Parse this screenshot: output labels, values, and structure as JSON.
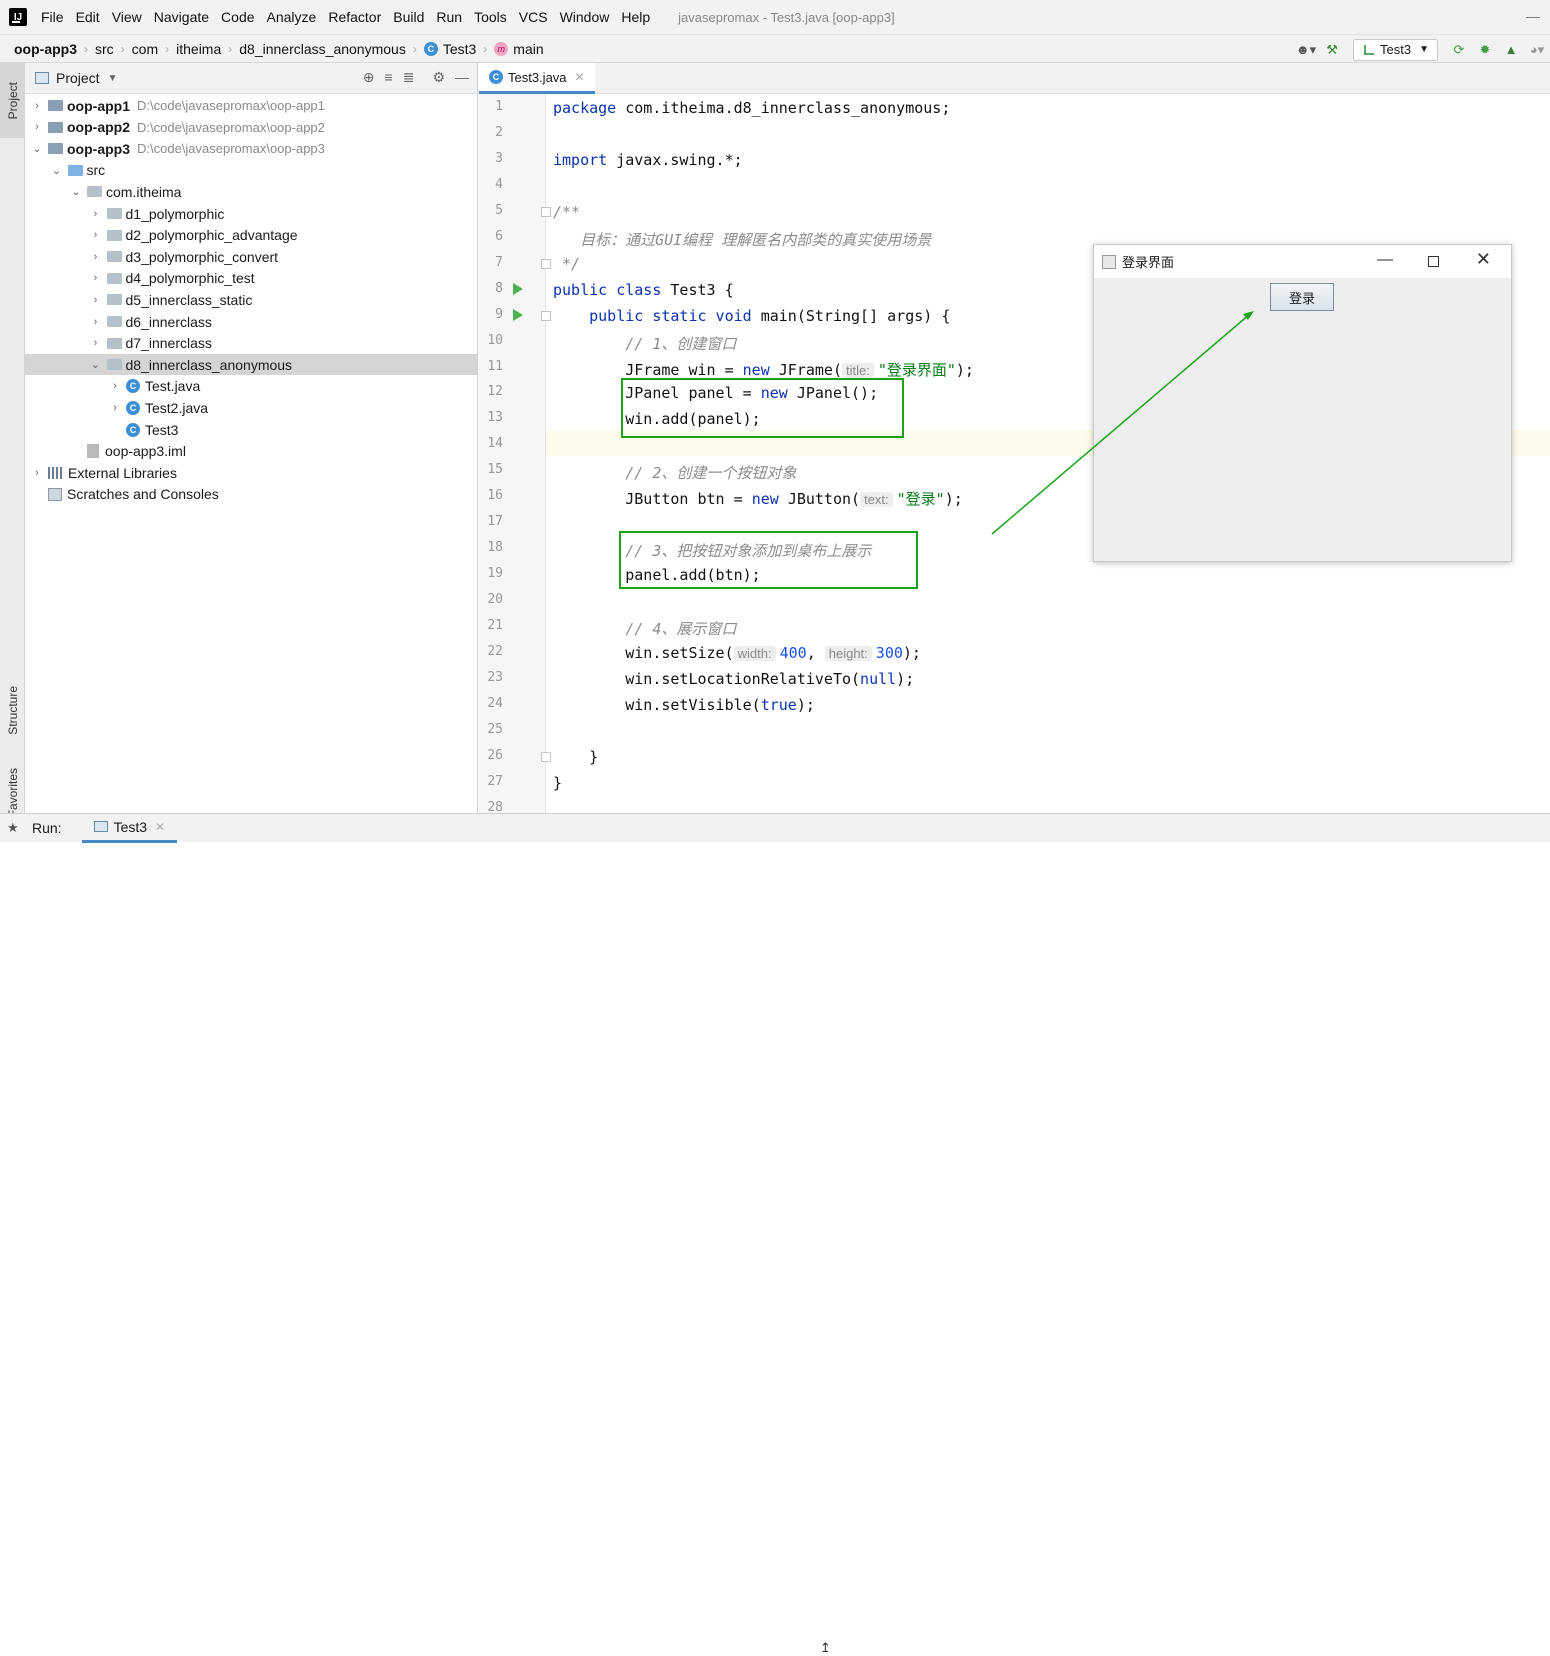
{
  "menubar": {
    "logo": "IJ",
    "items": [
      "File",
      "Edit",
      "View",
      "Navigate",
      "Code",
      "Analyze",
      "Refactor",
      "Build",
      "Run",
      "Tools",
      "VCS",
      "Window",
      "Help"
    ],
    "underline": [
      "F",
      "E",
      "V",
      "N",
      "C",
      "z",
      "R",
      "B",
      "u",
      "T",
      "S",
      "W",
      "H"
    ],
    "window_title": "javasepromax - Test3.java [oop-app3]"
  },
  "breadcrumb": {
    "items": [
      "oop-app3",
      "src",
      "com",
      "itheima",
      "d8_innerclass_anonymous",
      "Test3",
      "main"
    ],
    "class_badge": "C",
    "method_badge": "m"
  },
  "toolbar": {
    "run_config": "Test3"
  },
  "left_strip": {
    "project": "Project",
    "structure": "Structure",
    "favorites": "Favorites"
  },
  "project_panel": {
    "title": "Project",
    "tree": [
      {
        "label": "oop-app1",
        "path": "D:\\code\\javasepromax\\oop-app1",
        "depth": 0,
        "arrow": "›",
        "icon": "module",
        "bold": true
      },
      {
        "label": "oop-app2",
        "path": "D:\\code\\javasepromax\\oop-app2",
        "depth": 0,
        "arrow": "›",
        "icon": "module",
        "bold": true
      },
      {
        "label": "oop-app3",
        "path": "D:\\code\\javasepromax\\oop-app3",
        "depth": 0,
        "arrow": "⌄",
        "icon": "module",
        "bold": true
      },
      {
        "label": "src",
        "path": "",
        "depth": 1,
        "arrow": "⌄",
        "icon": "src",
        "bold": false
      },
      {
        "label": "com.itheima",
        "path": "",
        "depth": 2,
        "arrow": "⌄",
        "icon": "pkg",
        "bold": false
      },
      {
        "label": "d1_polymorphic",
        "path": "",
        "depth": 3,
        "arrow": "›",
        "icon": "pkg",
        "bold": false
      },
      {
        "label": "d2_polymorphic_advantage",
        "path": "",
        "depth": 3,
        "arrow": "›",
        "icon": "pkg",
        "bold": false
      },
      {
        "label": "d3_polymorphic_convert",
        "path": "",
        "depth": 3,
        "arrow": "›",
        "icon": "pkg",
        "bold": false
      },
      {
        "label": "d4_polymorphic_test",
        "path": "",
        "depth": 3,
        "arrow": "›",
        "icon": "pkg",
        "bold": false
      },
      {
        "label": "d5_innerclass_static",
        "path": "",
        "depth": 3,
        "arrow": "›",
        "icon": "pkg",
        "bold": false
      },
      {
        "label": "d6_innerclass",
        "path": "",
        "depth": 3,
        "arrow": "›",
        "icon": "pkg",
        "bold": false
      },
      {
        "label": "d7_innerclass",
        "path": "",
        "depth": 3,
        "arrow": "›",
        "icon": "pkg",
        "bold": false
      },
      {
        "label": "d8_innerclass_anonymous",
        "path": "",
        "depth": 3,
        "arrow": "⌄",
        "icon": "pkg",
        "bold": false,
        "selected": true
      },
      {
        "label": "Test.java",
        "path": "",
        "depth": 4,
        "arrow": "›",
        "icon": "class",
        "bold": false
      },
      {
        "label": "Test2.java",
        "path": "",
        "depth": 4,
        "arrow": "›",
        "icon": "class",
        "bold": false
      },
      {
        "label": "Test3",
        "path": "",
        "depth": 4,
        "arrow": "",
        "icon": "class",
        "bold": false
      },
      {
        "label": "oop-app3.iml",
        "path": "",
        "depth": 2,
        "arrow": "",
        "icon": "iml",
        "bold": false
      },
      {
        "label": "External Libraries",
        "path": "",
        "depth": 0,
        "arrow": "›",
        "icon": "lib",
        "bold": false
      },
      {
        "label": "Scratches and Consoles",
        "path": "",
        "depth": 0,
        "arrow": "",
        "icon": "scratch",
        "bold": false
      }
    ]
  },
  "editor": {
    "tab": "Test3.java",
    "tab_badge": "C",
    "line_numbers": [
      "1",
      "2",
      "3",
      "4",
      "5",
      "6",
      "7",
      "8",
      "9",
      "10",
      "11",
      "12",
      "13",
      "14",
      "15",
      "16",
      "17",
      "18",
      "19",
      "20",
      "21",
      "22",
      "23",
      "24",
      "25",
      "26",
      "27",
      "28"
    ],
    "lines": [
      [
        {
          "t": "package ",
          "c": "kw"
        },
        {
          "t": "com.itheima.d8_innerclass_anonymous;",
          "c": ""
        }
      ],
      [],
      [
        {
          "t": "import ",
          "c": "kw"
        },
        {
          "t": "javax.swing.*;",
          "c": ""
        }
      ],
      [],
      [
        {
          "t": "/**",
          "c": "cmt"
        }
      ],
      [
        {
          "t": "   目标：通过GUI编程 理解匿名内部类的真实使用场景",
          "c": "cmt"
        }
      ],
      [
        {
          "t": " */",
          "c": "cmt"
        }
      ],
      [
        {
          "t": "public class ",
          "c": "kw"
        },
        {
          "t": "Test3 {",
          "c": ""
        }
      ],
      [
        {
          "t": "    public static void ",
          "c": "kw"
        },
        {
          "t": "main(String[] args) {",
          "c": ""
        }
      ],
      [
        {
          "t": "        // 1、创建窗口",
          "c": "cmt"
        }
      ],
      [
        {
          "t": "        JFrame win = ",
          "c": ""
        },
        {
          "t": "new ",
          "c": "kw"
        },
        {
          "t": "JFrame(",
          "c": ""
        },
        {
          "t": "title:",
          "c": "hint"
        },
        {
          "t": "\"登录界面\"",
          "c": "str"
        },
        {
          "t": ");",
          "c": ""
        }
      ],
      [
        {
          "t": "        JPanel panel = ",
          "c": ""
        },
        {
          "t": "new ",
          "c": "kw"
        },
        {
          "t": "JPanel();",
          "c": ""
        }
      ],
      [
        {
          "t": "        win.add(panel);",
          "c": ""
        }
      ],
      [],
      [
        {
          "t": "        // 2、创建一个按钮对象",
          "c": "cmt"
        }
      ],
      [
        {
          "t": "        JButton btn = ",
          "c": ""
        },
        {
          "t": "new ",
          "c": "kw"
        },
        {
          "t": "JButton(",
          "c": ""
        },
        {
          "t": "text:",
          "c": "hint"
        },
        {
          "t": "\"登录\"",
          "c": "str"
        },
        {
          "t": ");",
          "c": ""
        }
      ],
      [],
      [
        {
          "t": "        // 3、把按钮对象添加到桌布上展示",
          "c": "cmt"
        }
      ],
      [
        {
          "t": "        panel.add(btn);",
          "c": ""
        }
      ],
      [],
      [
        {
          "t": "        // 4、展示窗口",
          "c": "cmt"
        }
      ],
      [
        {
          "t": "        win.setSize(",
          "c": ""
        },
        {
          "t": "width:",
          "c": "hint"
        },
        {
          "t": "400",
          "c": "num"
        },
        {
          "t": ", ",
          "c": ""
        },
        {
          "t": "height:",
          "c": "hint"
        },
        {
          "t": "300",
          "c": "num"
        },
        {
          "t": ");",
          "c": ""
        }
      ],
      [
        {
          "t": "        win.setLocationRelativeTo(",
          "c": ""
        },
        {
          "t": "null",
          "c": "kw"
        },
        {
          "t": ");",
          "c": ""
        }
      ],
      [
        {
          "t": "        win.setVisible(",
          "c": ""
        },
        {
          "t": "true",
          "c": "kw"
        },
        {
          "t": ");",
          "c": ""
        }
      ],
      [],
      [
        {
          "t": "    }",
          "c": ""
        }
      ],
      [
        {
          "t": "}",
          "c": ""
        }
      ],
      []
    ]
  },
  "login_frame": {
    "title": "登录界面",
    "button": "登录"
  },
  "runbar": {
    "label": "Run:",
    "tab": "Test3"
  },
  "colors": {
    "accent": "#4a88c7",
    "highlight_box": "#1aa31a",
    "keyword": "#0b33b0",
    "string": "#067d17",
    "comment": "#8c8c8c",
    "number": "#1750eb"
  }
}
